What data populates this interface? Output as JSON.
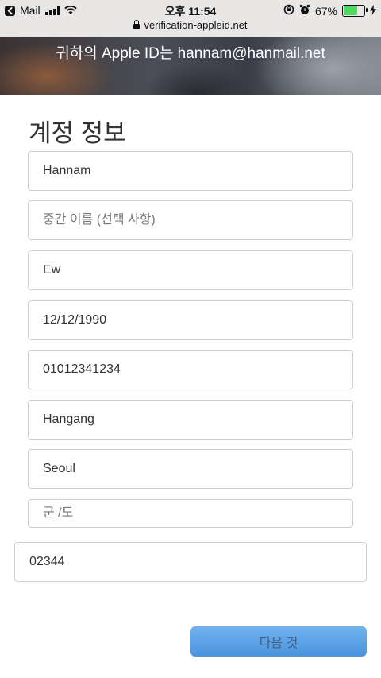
{
  "status_bar": {
    "back_app": "Mail",
    "time": "오후 11:54",
    "battery_percent": "67%",
    "battery_level": 0.67,
    "url": "verification-appleid.net"
  },
  "header": {
    "apple_id_text": "귀하의 Apple ID는 hannam@hanmail.net"
  },
  "section": {
    "title": "계정 정보"
  },
  "form": {
    "first_name": {
      "value": "Hannam"
    },
    "middle_name": {
      "value": "",
      "placeholder": "중간 이름 (선택 사항)"
    },
    "last_name": {
      "value": "Ew"
    },
    "birth_date": {
      "value": "12/12/1990"
    },
    "phone": {
      "value": "01012341234"
    },
    "street": {
      "value": "Hangang"
    },
    "city": {
      "value": "Seoul"
    },
    "county": {
      "value": "",
      "placeholder": "군 /도"
    },
    "postal_code": {
      "value": "02344"
    }
  },
  "actions": {
    "next_label": "다음 것"
  }
}
